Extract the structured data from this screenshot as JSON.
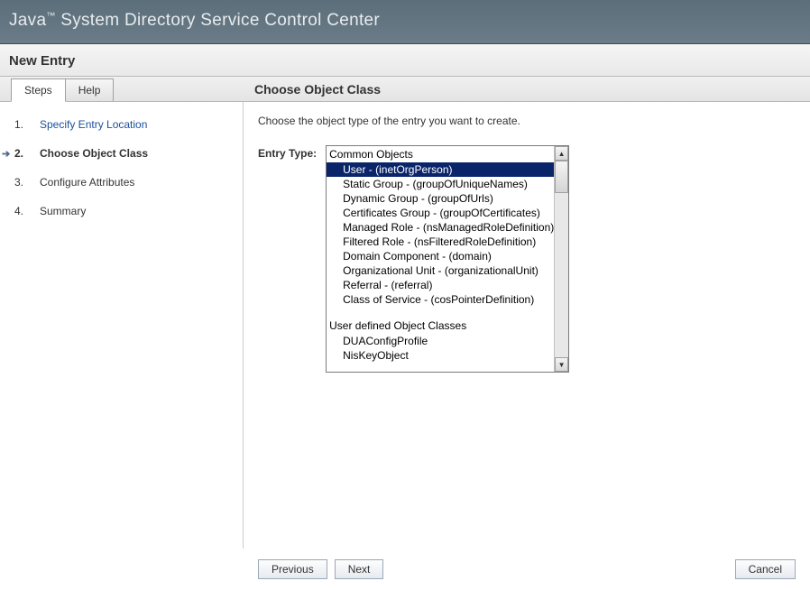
{
  "banner": {
    "prefix": "Java",
    "tm": "™",
    "suffix": " System Directory Service Control Center"
  },
  "page_title": "New Entry",
  "tabs": [
    {
      "label": "Steps",
      "active": true
    },
    {
      "label": "Help",
      "active": false
    }
  ],
  "panel_title": "Choose Object Class",
  "steps": [
    {
      "num": "1.",
      "label": "Specify Entry Location",
      "link": true,
      "current": false
    },
    {
      "num": "2.",
      "label": "Choose Object Class",
      "link": false,
      "current": true
    },
    {
      "num": "3.",
      "label": "Configure Attributes",
      "link": false,
      "current": false
    },
    {
      "num": "4.",
      "label": "Summary",
      "link": false,
      "current": false
    }
  ],
  "instruction": "Choose the object type of the entry you want to create.",
  "field_label": "Entry Type:",
  "listbox": {
    "groups": [
      {
        "header": "Common Objects",
        "items": [
          {
            "label": "User - (inetOrgPerson)",
            "selected": true
          },
          {
            "label": "Static Group - (groupOfUniqueNames)",
            "selected": false
          },
          {
            "label": "Dynamic Group - (groupOfUrls)",
            "selected": false
          },
          {
            "label": "Certificates Group - (groupOfCertificates)",
            "selected": false
          },
          {
            "label": "Managed Role - (nsManagedRoleDefinition)",
            "selected": false
          },
          {
            "label": "Filtered Role - (nsFilteredRoleDefinition)",
            "selected": false
          },
          {
            "label": "Domain Component - (domain)",
            "selected": false
          },
          {
            "label": "Organizational Unit - (organizationalUnit)",
            "selected": false
          },
          {
            "label": "Referral - (referral)",
            "selected": false
          },
          {
            "label": "Class of Service - (cosPointerDefinition)",
            "selected": false
          }
        ]
      },
      {
        "header": "User defined Object Classes",
        "items": [
          {
            "label": "DUAConfigProfile",
            "selected": false
          },
          {
            "label": "NisKeyObject",
            "selected": false
          }
        ]
      }
    ]
  },
  "buttons": {
    "previous": "Previous",
    "next": "Next",
    "cancel": "Cancel"
  },
  "glyphs": {
    "arrow": "➔",
    "up": "▲",
    "down": "▼"
  }
}
